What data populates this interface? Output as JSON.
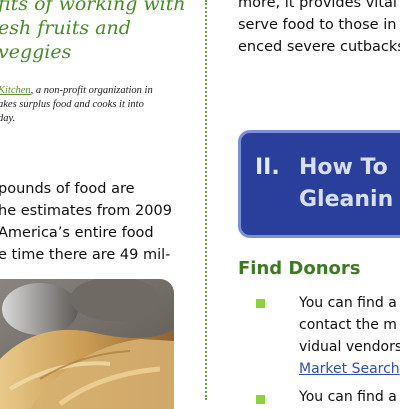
{
  "left_column": {
    "heading_lines": [
      "fits of working with",
      "esh fruits and veggies"
    ],
    "caption": {
      "link_text": "Kitchen",
      "line1_rest": ", a non-profit organization in",
      "line2": "akes surplus food and cooks it into",
      "line3": "day."
    },
    "body_lines": [
      "pounds of food are",
      "he estimates from 2009",
      "America’s entire food",
      "e time there are 49 mil-"
    ]
  },
  "right_column": {
    "body_lines": [
      "more, it provides vital",
      "serve food to those in",
      "enced severe cutbacks"
    ],
    "banner": {
      "number": "II.",
      "title_line1": "How To",
      "title_line2": "Gleanin"
    },
    "section_heading": "Find Donors",
    "list": [
      {
        "lines": [
          "You can find a",
          "contact the m",
          "vidual vendors"
        ],
        "link": "Market Search"
      },
      {
        "lines": [
          "You can find a"
        ]
      }
    ]
  },
  "colors": {
    "heading_green": "#4a8a2a",
    "section_green": "#3f7a21",
    "bullet_green": "#8cd13f",
    "banner_blue": "#2a3f9b",
    "banner_border": "#7d8fd6",
    "link_blue": "#2f4fb0"
  }
}
